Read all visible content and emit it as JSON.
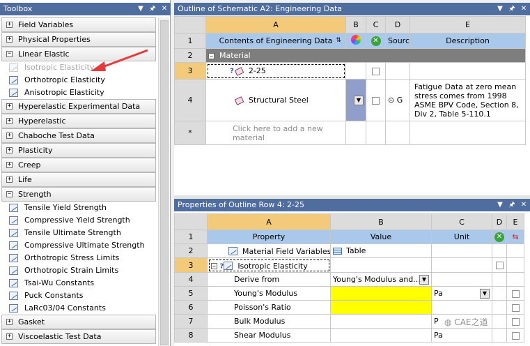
{
  "toolbox": {
    "title": "Toolbox",
    "categories": [
      {
        "label": "Field Variables",
        "expanded": false
      },
      {
        "label": "Physical Properties",
        "expanded": false
      },
      {
        "label": "Linear Elastic",
        "expanded": true,
        "items": [
          "Isotropic Elasticity",
          "Orthotropic Elasticity",
          "Anisotropic Elasticity"
        ]
      },
      {
        "label": "Hyperelastic Experimental Data",
        "expanded": false
      },
      {
        "label": "Hyperelastic",
        "expanded": false
      },
      {
        "label": "Chaboche Test Data",
        "expanded": false
      },
      {
        "label": "Plasticity",
        "expanded": false
      },
      {
        "label": "Creep",
        "expanded": false
      },
      {
        "label": "Life",
        "expanded": false
      },
      {
        "label": "Strength",
        "expanded": true,
        "items": [
          "Tensile Yield Strength",
          "Compressive Yield Strength",
          "Tensile Ultimate Strength",
          "Compressive Ultimate Strength",
          "Orthotropic Stress Limits",
          "Orthotropic Strain Limits",
          "Tsai-Wu Constants",
          "Puck Constants",
          "LaRc03/04 Constants"
        ]
      },
      {
        "label": "Gasket",
        "expanded": false
      },
      {
        "label": "Viscoelastic Test Data",
        "expanded": false
      }
    ]
  },
  "outline": {
    "title": "Outline of Schematic A2: Engineering Data",
    "col_letters": [
      "A",
      "B",
      "C",
      "D",
      "E"
    ],
    "headers": {
      "contents": "Contents of Engineering Data",
      "source": "Source",
      "description": "Description"
    },
    "rows": {
      "r1": "1",
      "r2": "2",
      "r3": "3",
      "r4": "4",
      "r5": "*",
      "material_group": "Material",
      "mat1": "2-25",
      "mat2": "Structural Steel",
      "mat2_source_text": "G",
      "mat2_description": "Fatigue Data at zero mean stress comes from 1998 ASME BPV Code, Section 8, Div 2, Table 5-110.1",
      "add_new": "Click here to add a new material"
    }
  },
  "properties": {
    "title": "Properties of Outline Row 4: 2-25",
    "col_letters": [
      "A",
      "B",
      "C",
      "D",
      "E"
    ],
    "headers": {
      "property": "Property",
      "value": "Value",
      "unit": "Unit"
    },
    "rows": [
      {
        "num": "1"
      },
      {
        "num": "2",
        "property": "Material Field Variables",
        "value": "Table",
        "unit": ""
      },
      {
        "num": "3",
        "property": "Isotropic Elasticity",
        "value": "",
        "unit": ""
      },
      {
        "num": "4",
        "property": "Derive from",
        "value": "Young's Modulus and...",
        "unit": ""
      },
      {
        "num": "5",
        "property": "Young's Modulus",
        "value": "",
        "unit": "Pa"
      },
      {
        "num": "6",
        "property": "Poisson's Ratio",
        "value": "",
        "unit": ""
      },
      {
        "num": "7",
        "property": "Bulk Modulus",
        "value": "",
        "unit": "P"
      },
      {
        "num": "8",
        "property": "Shear Modulus",
        "value": "",
        "unit": "Pa"
      }
    ]
  },
  "watermark": "CAE之道",
  "icons": {
    "pin": "pin-icon",
    "close": "close-icon",
    "dropdown": "chevron-down-icon"
  }
}
